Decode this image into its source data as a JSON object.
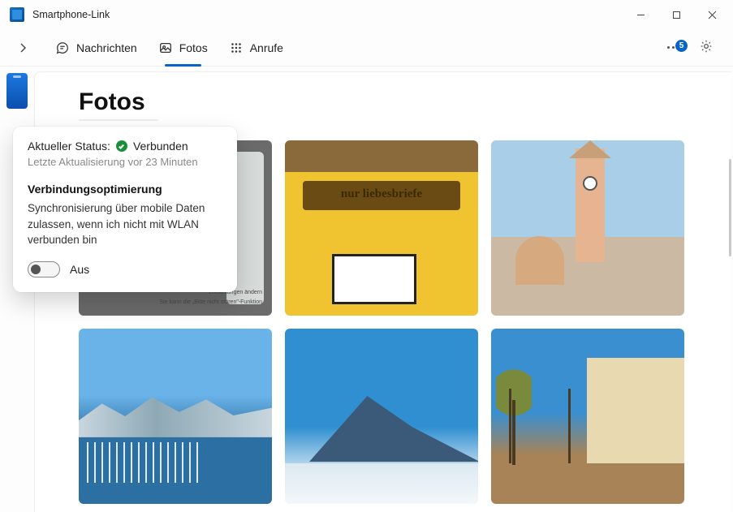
{
  "app": {
    "title": "Smartphone-Link"
  },
  "tabs": {
    "messages": "Nachrichten",
    "photos": "Fotos",
    "calls": "Anrufe"
  },
  "notif_badge": "5",
  "page": {
    "heading": "Fotos"
  },
  "first_tile": {
    "line1": "Einstellungen ändern",
    "line2": "Sie kann die „Bitte nicht stören\"-Funktion"
  },
  "mailbox_text": "nur liebesbriefe",
  "flyout": {
    "status_label": "Aktueller Status:",
    "status_value": "Verbunden",
    "last_update": "Letzte Aktualisierung vor 23 Minuten",
    "opt_heading": "Verbindungsoptimierung",
    "opt_desc": "Synchronisierung über mobile Daten zulassen, wenn ich nicht mit WLAN verbunden bin",
    "toggle_label": "Aus"
  }
}
